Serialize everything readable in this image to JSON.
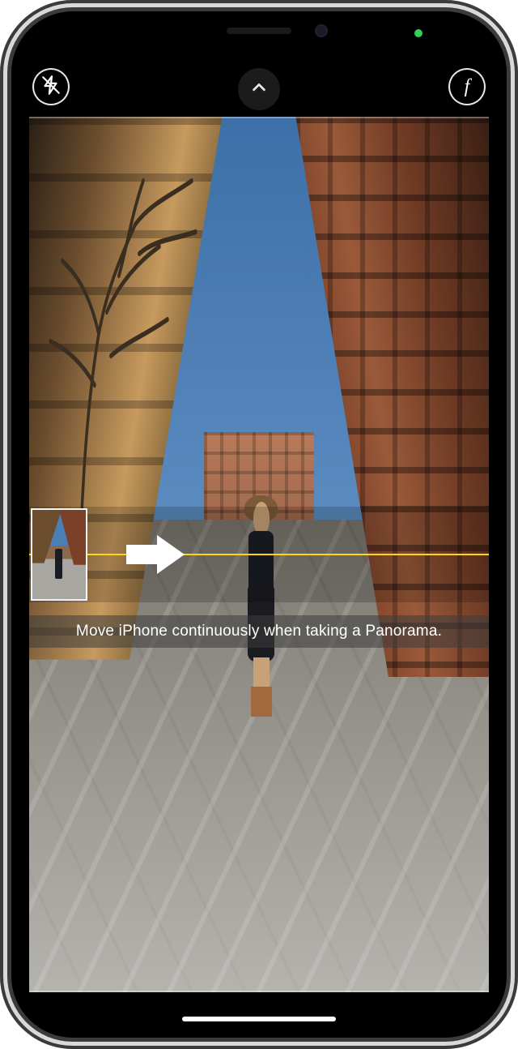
{
  "status": {
    "camera_indicator": "active"
  },
  "topControls": {
    "flash": "off",
    "filter_glyph": "f"
  },
  "panorama": {
    "hint": "Move iPhone continuously when taking a Panorama.",
    "direction": "right",
    "guide_color": "#ffd60a"
  },
  "icons": {
    "flash_off": "flash-off-icon",
    "chevron_up": "chevron-up-icon",
    "filters": "filters-icon",
    "arrow_right": "arrow-right-icon"
  }
}
